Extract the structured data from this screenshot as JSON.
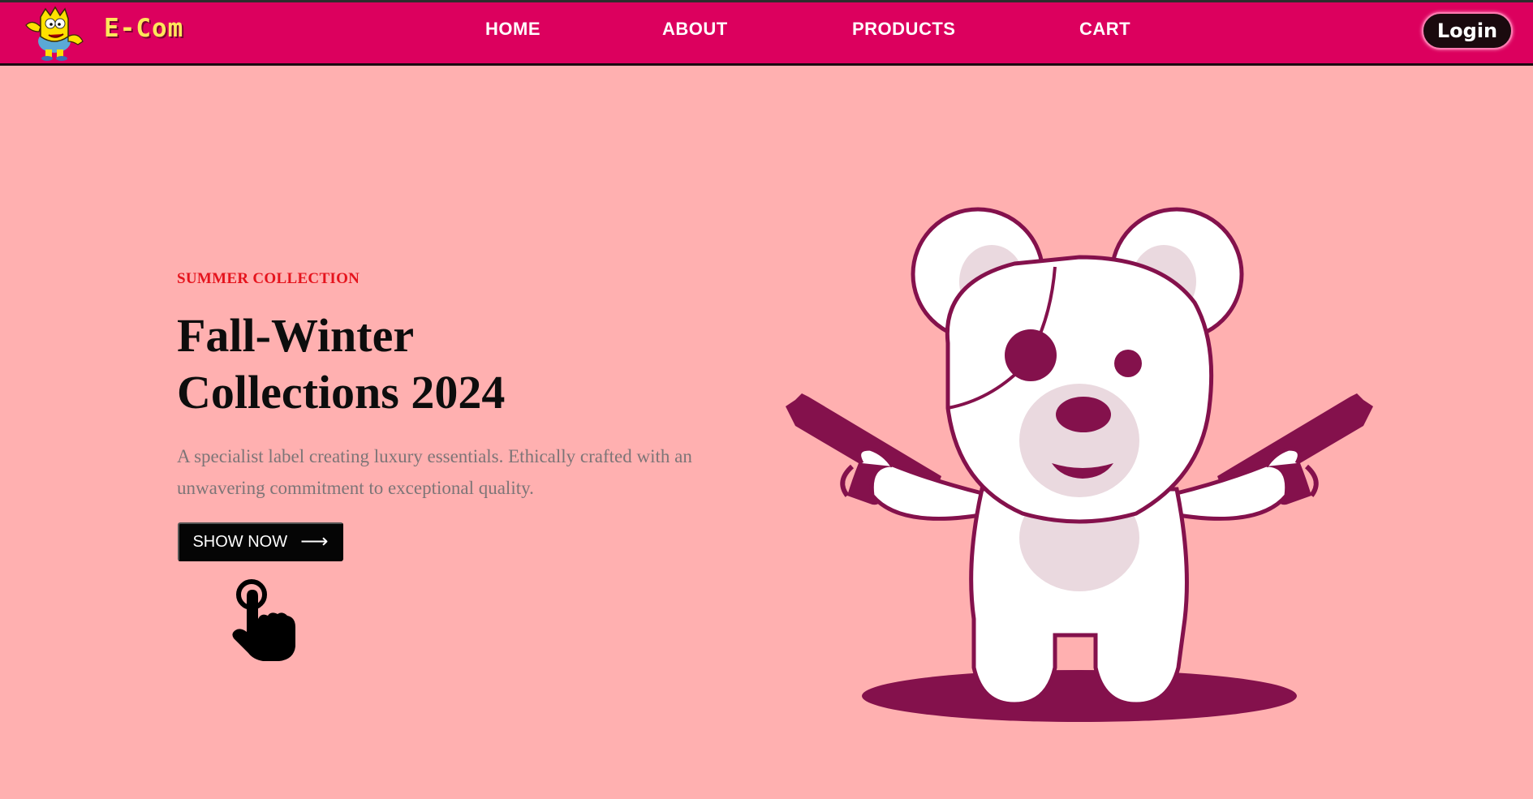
{
  "navbar": {
    "brand": "E-Com",
    "logo_icon": "cartoon-character-logo",
    "links": [
      {
        "label": "HOME"
      },
      {
        "label": "ABOUT"
      },
      {
        "label": "PRODUCTS"
      },
      {
        "label": "CART"
      }
    ],
    "login_label": "Login",
    "colors": {
      "background": "#dc005e",
      "brand_text": "#ffe65a",
      "login_bg": "#1a0a0e"
    }
  },
  "hero": {
    "eyebrow": "SUMMER COLLECTION",
    "headline_line1": "Fall-Winter",
    "headline_line2": "Collections 2024",
    "description": "A specialist label creating luxury essentials. Ethically crafted with an unwavering commitment to exceptional quality.",
    "cta_label": "SHOW NOW",
    "cta_icon": "arrow-right-icon",
    "pointer_icon": "pointing-hand-icon",
    "illustration": "teddy-bear-with-pistols",
    "colors": {
      "background": "#ffb0b0",
      "eyebrow": "#e5141d",
      "accent": "#84114c"
    }
  }
}
